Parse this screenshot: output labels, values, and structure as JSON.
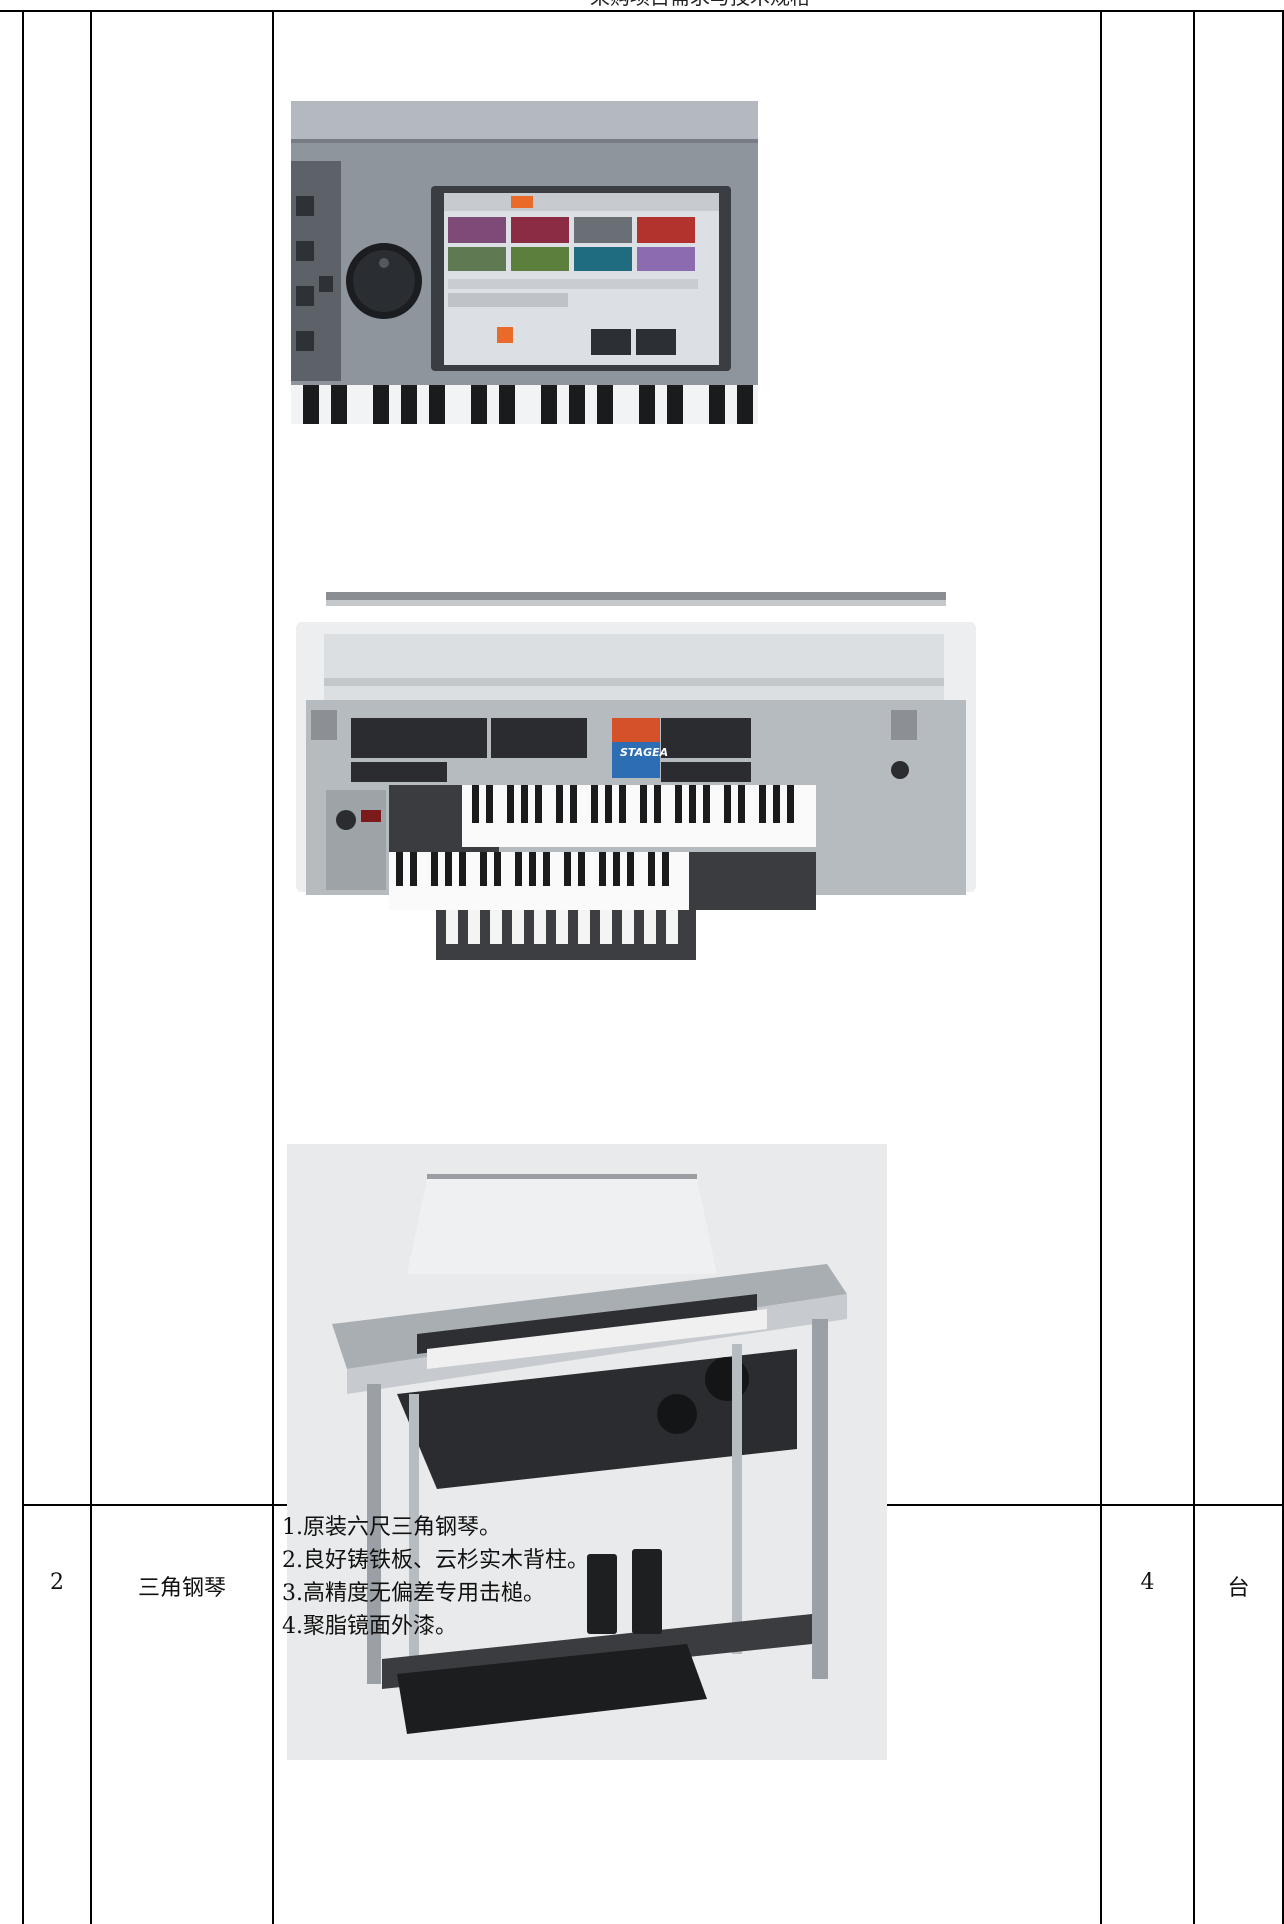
{
  "header": {
    "text": "采购项目需求与技术规格"
  },
  "images": [
    {
      "name": "arranger-keyboard-screen-photo",
      "alt": "键盘面板与显示屏"
    },
    {
      "name": "electone-console-top-photo",
      "alt": "STAGEA 电子琴控制台"
    },
    {
      "name": "electone-full-photo",
      "alt": "电子琴整机"
    }
  ],
  "screen_brand": "STAGEA",
  "row": {
    "index": "2",
    "name": "三角钢琴",
    "specs": [
      "1.原装六尺三角钢琴。",
      "2.良好铸铁板、云杉实木背柱。",
      "3.高精度无偏差专用击槌。",
      "4.聚脂镜面外漆。"
    ],
    "quantity": "4",
    "unit": "台"
  }
}
